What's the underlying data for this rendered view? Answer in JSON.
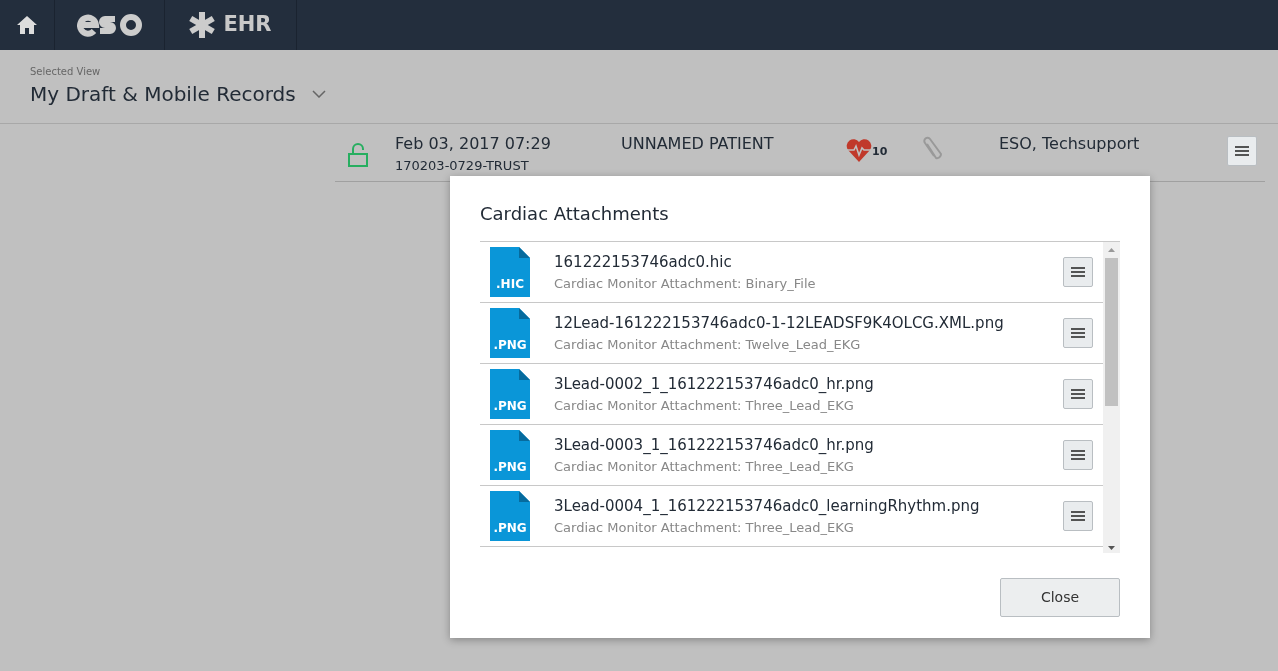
{
  "nav": {
    "app_label": "EHR"
  },
  "view": {
    "caption": "Selected View",
    "title": "My Draft & Mobile Records"
  },
  "record": {
    "locked": false,
    "date": "Feb 03, 2017 07:29",
    "number": "170203-0729-TRUST",
    "patient": "UNNAMED PATIENT",
    "cardiac_count": "10",
    "author": "ESO, Techsupport"
  },
  "modal": {
    "title": "Cardiac Attachments",
    "close_label": "Close",
    "attachments": [
      {
        "ext": ".HIC",
        "name": "161222153746adc0.hic",
        "type": "Cardiac Monitor Attachment: Binary_File"
      },
      {
        "ext": ".PNG",
        "name": "12Lead-161222153746adc0-1-12LEADSF9K4OLCG.XML.png",
        "type": "Cardiac Monitor Attachment: Twelve_Lead_EKG"
      },
      {
        "ext": ".PNG",
        "name": "3Lead-0002_1_161222153746adc0_hr.png",
        "type": "Cardiac Monitor Attachment: Three_Lead_EKG"
      },
      {
        "ext": ".PNG",
        "name": "3Lead-0003_1_161222153746adc0_hr.png",
        "type": "Cardiac Monitor Attachment: Three_Lead_EKG"
      },
      {
        "ext": ".PNG",
        "name": "3Lead-0004_1_161222153746adc0_learningRhythm.png",
        "type": "Cardiac Monitor Attachment: Three_Lead_EKG"
      }
    ]
  }
}
